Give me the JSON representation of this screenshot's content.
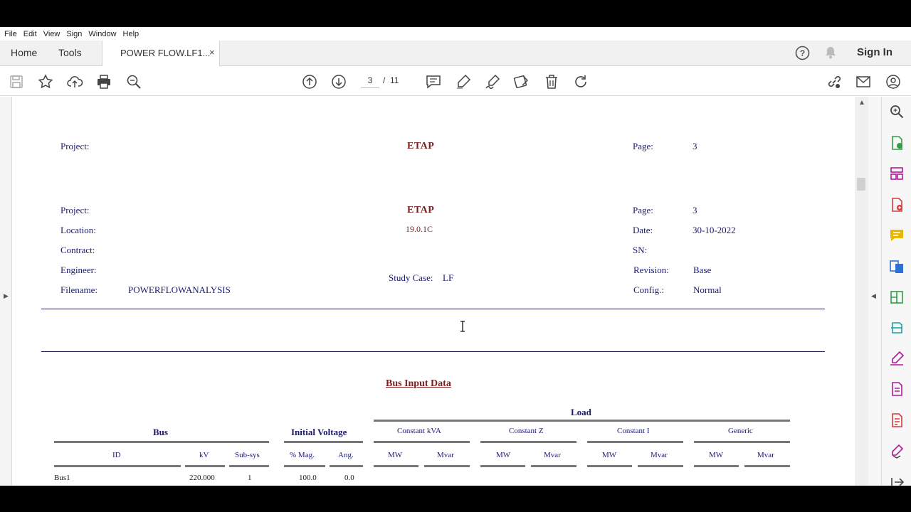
{
  "menu": [
    "File",
    "Edit",
    "View",
    "Sign",
    "Window",
    "Help"
  ],
  "tabs": {
    "home": "Home",
    "tools": "Tools",
    "document": "POWER FLOW.LF1...",
    "close": "×",
    "signin": "Sign In"
  },
  "toolbar": {
    "current_page": "3",
    "separator": "/",
    "total_pages": "11",
    "icons": [
      "save-icon",
      "star-icon",
      "upload-icon",
      "print-icon",
      "zoom-icon",
      "page-up-icon",
      "page-down-icon",
      "comment-icon",
      "highlight-icon",
      "sign-icon",
      "edit-icon",
      "delete-icon",
      "rotate-icon",
      "share-link-icon",
      "email-icon",
      "account-icon"
    ]
  },
  "header1": {
    "project_label": "Project:",
    "brand": "ETAP",
    "page_label": "Page:",
    "page_value": "3"
  },
  "header2": {
    "project_label": "Project:",
    "brand": "ETAP",
    "page_label": "Page:",
    "page_value": "3",
    "location_label": "Location:",
    "version": "19.0.1C",
    "date_label": "Date:",
    "date_value": "30-10-2022",
    "contract_label": "Contract:",
    "sn_label": "SN:",
    "engineer_label": "Engineer:",
    "study_case_label": "Study Case:",
    "study_case_value": "LF",
    "revision_label": "Revision:",
    "revision_value": "Base",
    "filename_label": "Filename:",
    "filename_value": "POWERFLOWANALYSIS",
    "config_label": "Config.:",
    "config_value": "Normal"
  },
  "bus_table": {
    "title": "Bus Input Data",
    "group_load": "Load",
    "group_bus": "Bus",
    "group_voltage": "Initial Voltage",
    "sub_kva": "Constant kVA",
    "sub_z": "Constant Z",
    "sub_i": "Constant I",
    "sub_generic": "Generic",
    "col_id": "ID",
    "col_kv": "kV",
    "col_subsys": "Sub-sys",
    "col_mag": "% Mag.",
    "col_ang": "Ang.",
    "col_mw": "MW",
    "col_mvar": "Mvar",
    "rows": [
      {
        "id": "Bus1",
        "kv": "220.000",
        "subsys": "1",
        "mag": "100.0",
        "ang": "0.0"
      }
    ]
  },
  "colors": {
    "brand_red": "#7a1f1f",
    "text_navy": "#1a1a6e",
    "accent_pink": "#b5179e",
    "accent_blue": "#2d6fd2",
    "accent_green": "#2f9e44",
    "accent_yellow": "#e8b800"
  }
}
